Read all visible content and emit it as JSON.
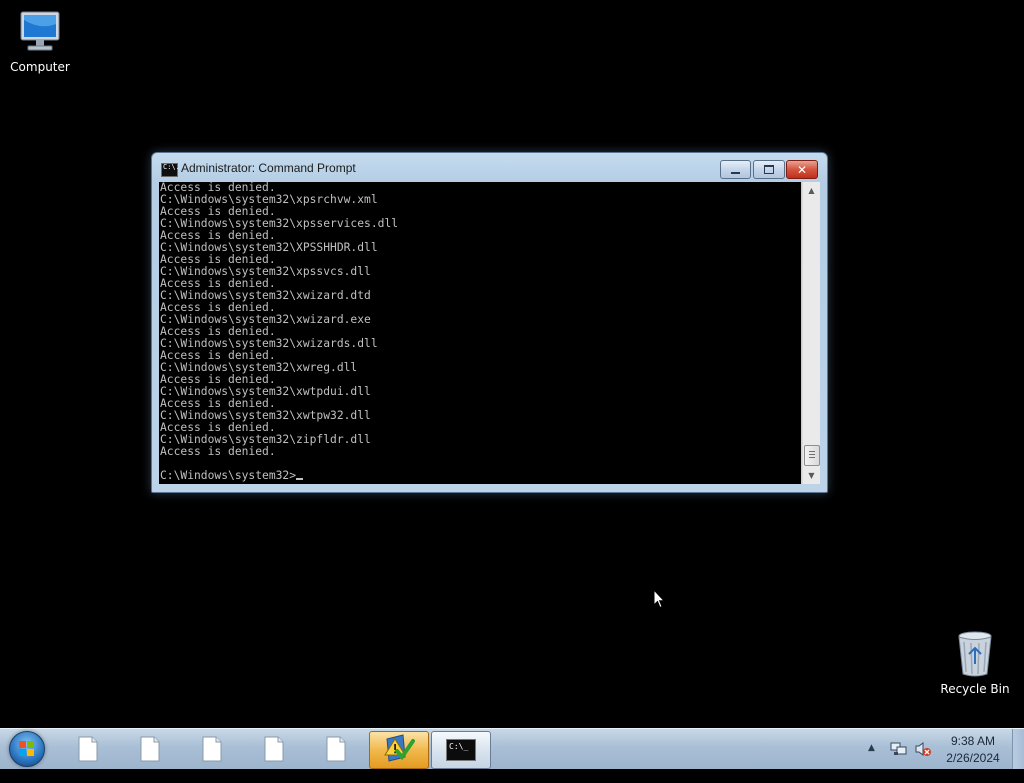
{
  "desktop": {
    "icons": [
      {
        "label": "Computer"
      },
      {
        "label": "Recycle Bin"
      }
    ]
  },
  "window": {
    "title": "Administrator:  Command Prompt",
    "icon_text": "C:\\.",
    "console_lines": [
      "Access is denied.",
      "C:\\Windows\\system32\\xpsrchvw.xml",
      "Access is denied.",
      "C:\\Windows\\system32\\xpsservices.dll",
      "Access is denied.",
      "C:\\Windows\\system32\\XPSSHHDR.dll",
      "Access is denied.",
      "C:\\Windows\\system32\\xpssvcs.dll",
      "Access is denied.",
      "C:\\Windows\\system32\\xwizard.dtd",
      "Access is denied.",
      "C:\\Windows\\system32\\xwizard.exe",
      "Access is denied.",
      "C:\\Windows\\system32\\xwizards.dll",
      "Access is denied.",
      "C:\\Windows\\system32\\xwreg.dll",
      "Access is denied.",
      "C:\\Windows\\system32\\xwtpdui.dll",
      "Access is denied.",
      "C:\\Windows\\system32\\xwtpw32.dll",
      "Access is denied.",
      "C:\\Windows\\system32\\zipfldr.dll",
      "Access is denied.",
      "",
      "C:\\Windows\\system32>"
    ]
  },
  "taskbar": {
    "cmd_icon_text": "C:\\_",
    "clock": {
      "time": "9:38 AM",
      "date": "2/26/2024"
    }
  },
  "colors": {
    "desktop": "#000000",
    "console_bg": "#000000",
    "console_text": "#c0c0c0",
    "close_button": "#c7402a",
    "highlight_task": "#f1b94d"
  }
}
